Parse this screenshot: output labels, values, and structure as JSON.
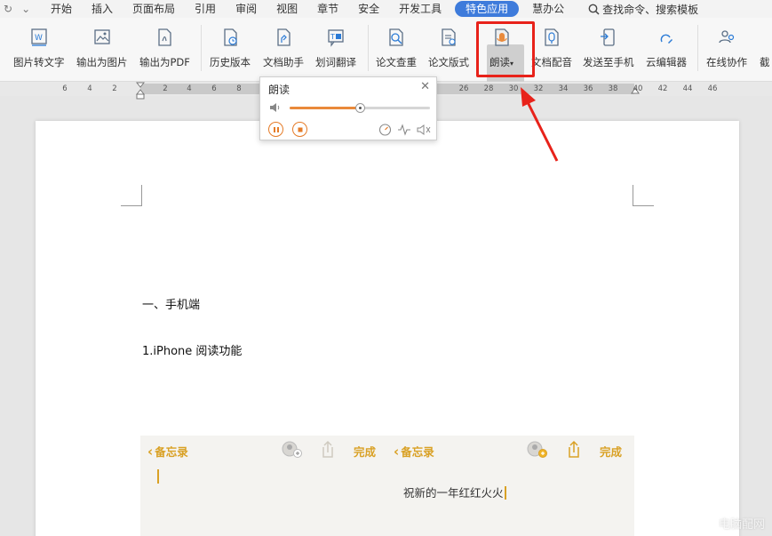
{
  "menubar": {
    "tabs": [
      "开始",
      "插入",
      "页面布局",
      "引用",
      "审阅",
      "视图",
      "章节",
      "安全",
      "开发工具",
      "特色应用",
      "慧办公"
    ],
    "active_tab": "特色应用",
    "search_label": "查找命令、搜索模板"
  },
  "toolbar": {
    "items": [
      {
        "label": "图片转文字",
        "icon": "image-to-text-icon"
      },
      {
        "label": "输出为图片",
        "icon": "export-image-icon"
      },
      {
        "label": "输出为PDF",
        "icon": "export-pdf-icon"
      },
      {
        "label": "历史版本",
        "icon": "history-icon"
      },
      {
        "label": "文档助手",
        "icon": "doc-assistant-icon"
      },
      {
        "label": "划词翻译",
        "icon": "translate-icon"
      },
      {
        "label": "论文查重",
        "icon": "plagiarism-check-icon"
      },
      {
        "label": "论文版式",
        "icon": "paper-format-icon"
      },
      {
        "label": "朗读",
        "icon": "read-aloud-icon"
      },
      {
        "label": "文档配音",
        "icon": "doc-voice-icon"
      },
      {
        "label": "发送至手机",
        "icon": "send-to-phone-icon"
      },
      {
        "label": "云编辑器",
        "icon": "cloud-editor-icon"
      },
      {
        "label": "在线协作",
        "icon": "online-collab-icon"
      },
      {
        "label": "截",
        "icon": "screenshot-icon"
      }
    ]
  },
  "ruler": {
    "numbers": [
      "6",
      "4",
      "2",
      "2",
      "4",
      "6",
      "8",
      "26",
      "28",
      "30",
      "32",
      "34",
      "36",
      "38",
      "40",
      "42",
      "44",
      "46"
    ]
  },
  "popup": {
    "title": "朗读",
    "volume_level": 0.5
  },
  "document": {
    "heading1": "一、手机端",
    "heading2": "1.iPhone 阅读功能"
  },
  "phone": {
    "back_label": "备忘录",
    "done_label": "完成",
    "note_text": "祝新的一年红红火火"
  },
  "watermark": "电脑配网",
  "colors": {
    "accent_tab": "#3e7bdb",
    "highlight": "#e8221a",
    "phone_accent": "#d9a125",
    "slider_fill": "#e98a3b"
  }
}
